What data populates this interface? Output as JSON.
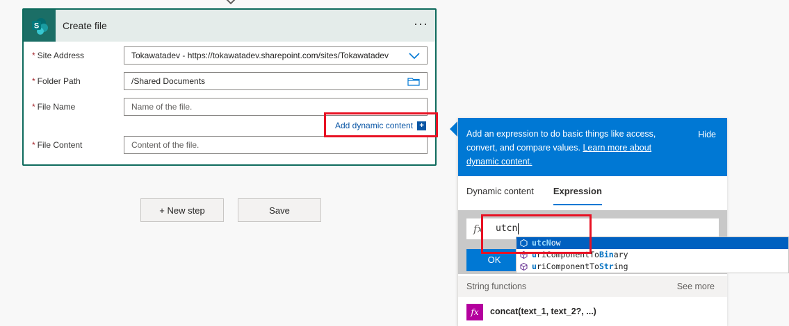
{
  "card": {
    "title": "Create file",
    "menu_label": "···"
  },
  "fields": {
    "required_mark": "*",
    "site_address": {
      "label": "Site Address",
      "value": "Tokawatadev - https://tokawatadev.sharepoint.com/sites/Tokawatadev"
    },
    "folder_path": {
      "label": "Folder Path",
      "value": "/Shared Documents"
    },
    "file_name": {
      "label": "File Name",
      "placeholder": "Name of the file."
    },
    "file_content": {
      "label": "File Content",
      "placeholder": "Content of the file."
    }
  },
  "dynamic_link": {
    "label": "Add dynamic content",
    "plus": "+"
  },
  "actions": {
    "new_step": "+ New step",
    "save": "Save"
  },
  "panel": {
    "info_text": "Add an expression to do basic things like access, convert, and compare values.",
    "info_link": "Learn more about dynamic content.",
    "hide": "Hide",
    "tabs": [
      {
        "label": "Dynamic content",
        "active": false
      },
      {
        "label": "Expression",
        "active": true
      }
    ],
    "fx": "fx",
    "expression_value": "utcn",
    "ok_label": "OK",
    "section_title": "String functions",
    "see_more": "See more",
    "function_name": "concat(text_1, text_2?, ...)"
  },
  "suggestions": [
    {
      "pre": "",
      "m1": "utc",
      "mid": "",
      "m2": "N",
      "post": "ow",
      "selected": true
    },
    {
      "pre": "",
      "m1": "u",
      "mid": "riComponentTo",
      "m2": "Bin",
      "post": "ary",
      "selected": false
    },
    {
      "pre": "",
      "m1": "u",
      "mid": "riComponentTo",
      "m2": "Str",
      "post": "ing",
      "selected": false
    }
  ],
  "colors": {
    "brand": "#0078d4",
    "card_border": "#0d6a5c",
    "highlight_box": "#e81123",
    "function_icon": "#b4009e"
  }
}
